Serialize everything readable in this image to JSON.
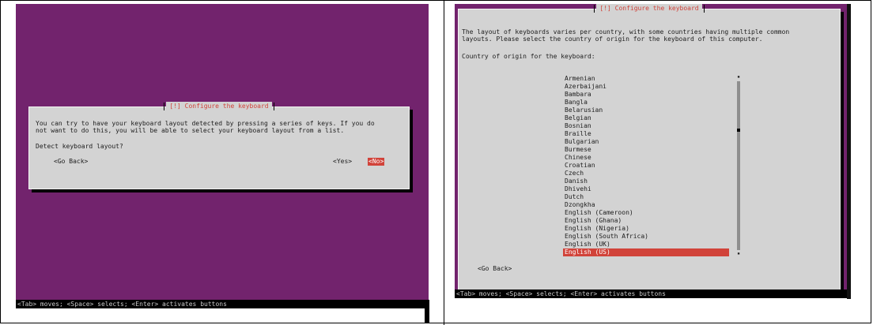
{
  "left": {
    "dialog_title": "[!] Configure the keyboard",
    "body_text_line1": "You can try to have your keyboard layout detected by pressing a series of keys. If you do",
    "body_text_line2": "not want to do this, you will be able to select your keyboard layout from a list.",
    "question": "Detect keyboard layout?",
    "go_back_label": "<Go Back>",
    "yes_label": "<Yes>",
    "no_label": "<No>",
    "status_bar": "<Tab> moves; <Space> selects; <Enter> activates buttons"
  },
  "right": {
    "dialog_title": "[!] Configure the keyboard",
    "body_text_line1": "The layout of keyboards varies per country, with some countries having multiple common",
    "body_text_line2": "layouts. Please select the country of origin for the keyboard of this computer.",
    "prompt": "Country of origin for the keyboard:",
    "countries": [
      "Armenian",
      "Azerbaijani",
      "Bambara",
      "Bangla",
      "Belarusian",
      "Belgian",
      "Bosnian",
      "Braille",
      "Bulgarian",
      "Burmese",
      "Chinese",
      "Croatian",
      "Czech",
      "Danish",
      "Dhivehi",
      "Dutch",
      "Dzongkha",
      "English (Cameroon)",
      "English (Ghana)",
      "English (Nigeria)",
      "English (South Africa)",
      "English (UK)",
      "English (US)"
    ],
    "selected_country": "English (US)",
    "scroll_up": "▪",
    "scroll_down": "▪",
    "go_back_label": "<Go Back>",
    "status_bar": "<Tab> moves; <Space> selects; <Enter> activates buttons"
  },
  "colors": {
    "desktop_purple": "#72236d",
    "dialog_gray": "#d3d3d3",
    "accent_red": "#d1433a"
  }
}
